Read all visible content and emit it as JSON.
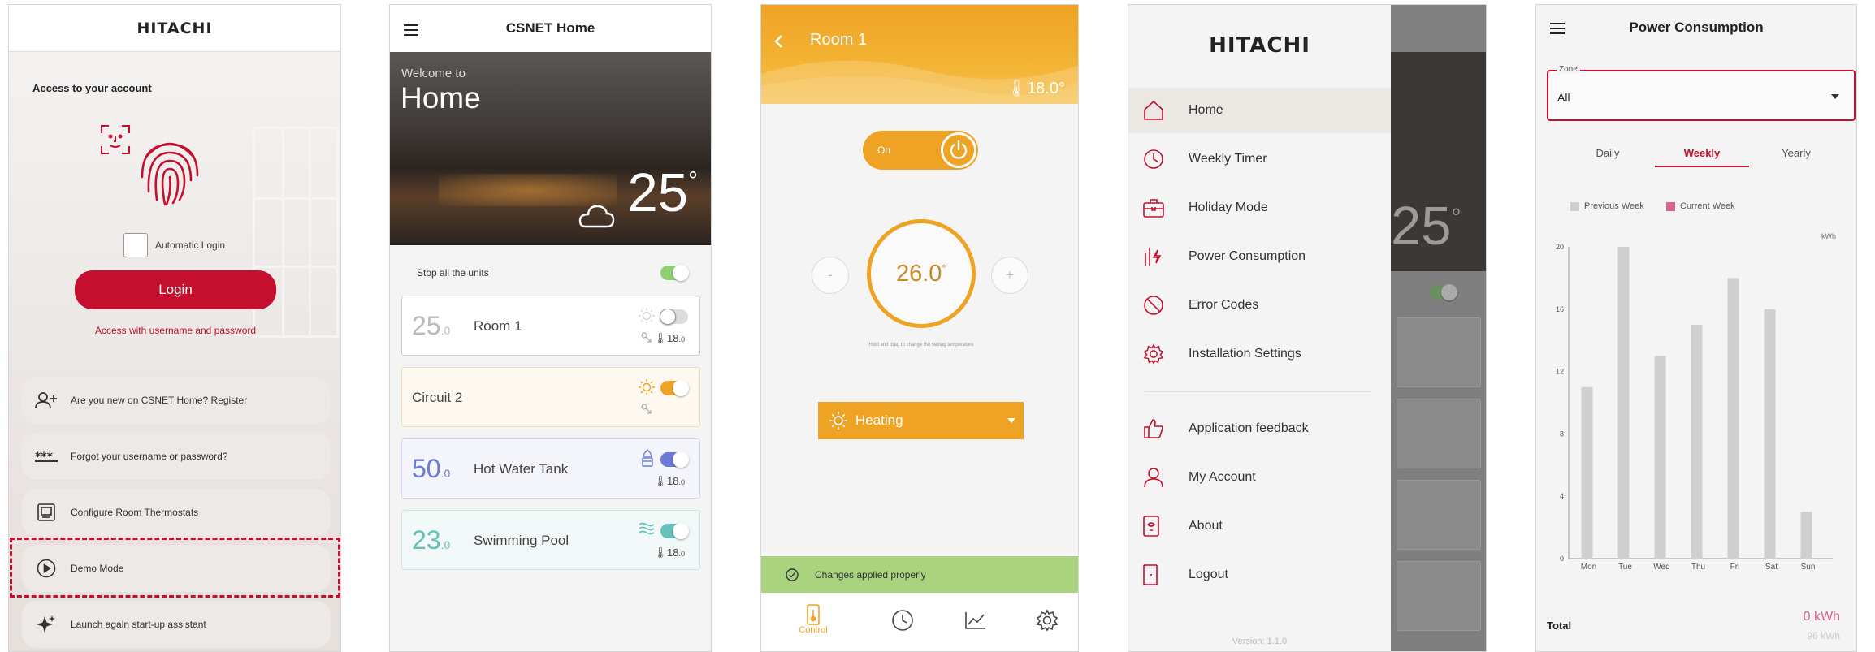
{
  "colors": {
    "brand_red": "#c4102e",
    "amber": "#efa325",
    "green_banner": "#a9d37f",
    "blue_toggle": "#6a7ad6",
    "teal": "#64c2ba",
    "chart_grey": "#cfcfcf"
  },
  "login": {
    "logo": "HITACHI",
    "access_title": "Access to your account",
    "auto_login_label": "Automatic Login",
    "login_button": "Login",
    "username_link": "Access with username and password",
    "options": [
      {
        "icon": "add-user-icon",
        "label": "Are you new on CSNET Home? Register"
      },
      {
        "icon": "password-asterisk-icon",
        "label": "Forgot your username or password?"
      },
      {
        "icon": "thermostat-icon",
        "label": "Configure Room Thermostats"
      },
      {
        "icon": "play-circle-icon",
        "label": "Demo Mode"
      },
      {
        "icon": "sparkle-icon",
        "label": "Launch again start-up assistant"
      }
    ]
  },
  "home": {
    "title": "CSNET Home",
    "welcome": "Welcome to",
    "home_name": "Home",
    "outdoor_temp": "25",
    "degree": "°",
    "stop_all_label": "Stop all the units",
    "units": [
      {
        "big": "25",
        "decimal": ".0",
        "name": "Room 1",
        "status_temp": "18",
        "status_dec": ".0",
        "state": "off",
        "accent": "#cfcfcf"
      },
      {
        "big": "",
        "decimal": "",
        "name": "Circuit 2",
        "status_temp": "",
        "status_dec": "",
        "state": "on",
        "accent": "#efa325"
      },
      {
        "big": "50",
        "decimal": ".0",
        "name": "Hot Water Tank",
        "status_temp": "18",
        "status_dec": ".0",
        "state": "on",
        "accent": "#6a7ad6"
      },
      {
        "big": "23",
        "decimal": ".0",
        "name": "Swimming Pool",
        "status_temp": "18",
        "status_dec": ".0",
        "state": "on",
        "accent": "#64c2ba"
      }
    ]
  },
  "room": {
    "title": "Room 1",
    "current_temp": "18.0°",
    "power_label": "On",
    "setpoint": "26.0",
    "setpoint_unit": "°",
    "minus": "-",
    "plus": "+",
    "hint": "Hold and drag to change the setting temperature",
    "mode": "Heating",
    "banner": "Changes applied properly",
    "tabs": [
      "Control"
    ]
  },
  "menu": {
    "logo": "HITACHI",
    "items": [
      {
        "icon": "home-icon",
        "label": "Home"
      },
      {
        "icon": "clock-icon",
        "label": "Weekly Timer"
      },
      {
        "icon": "suitcase-icon",
        "label": "Holiday Mode"
      },
      {
        "icon": "power-consumption-icon",
        "label": "Power Consumption"
      },
      {
        "icon": "error-icon",
        "label": "Error Codes"
      },
      {
        "icon": "settings-icon",
        "label": "Installation Settings"
      },
      {
        "icon": "thumbs-up-icon",
        "label": "Application feedback"
      },
      {
        "icon": "account-icon",
        "label": "My Account"
      },
      {
        "icon": "about-icon",
        "label": "About"
      },
      {
        "icon": "logout-icon",
        "label": "Logout"
      }
    ],
    "version": "Version: 1.1.0"
  },
  "power": {
    "title": "Power Consumption",
    "zone_label": "Zone",
    "zone_value": "All",
    "tabs": [
      "Daily",
      "Weekly",
      "Yearly"
    ],
    "legend_prev": "Previous Week",
    "legend_curr": "Current Week",
    "total_label": "Total",
    "total_value": "0 kWh",
    "prev_total": "96 kWh"
  },
  "chart_data": {
    "type": "bar",
    "categories": [
      "Mon",
      "Tue",
      "Wed",
      "Thu",
      "Fri",
      "Sat",
      "Sun"
    ],
    "series": [
      {
        "name": "Previous Week",
        "values": [
          11,
          20,
          13,
          15,
          18,
          16,
          3
        ]
      },
      {
        "name": "Current Week",
        "values": [
          0,
          0,
          0,
          0,
          0,
          0,
          0
        ]
      }
    ],
    "yunit": "kWh",
    "ylim": [
      0,
      20
    ],
    "yticks": [
      "0",
      "4",
      "8",
      "12",
      "16",
      "20"
    ],
    "grid": false,
    "legend_position": "top"
  }
}
